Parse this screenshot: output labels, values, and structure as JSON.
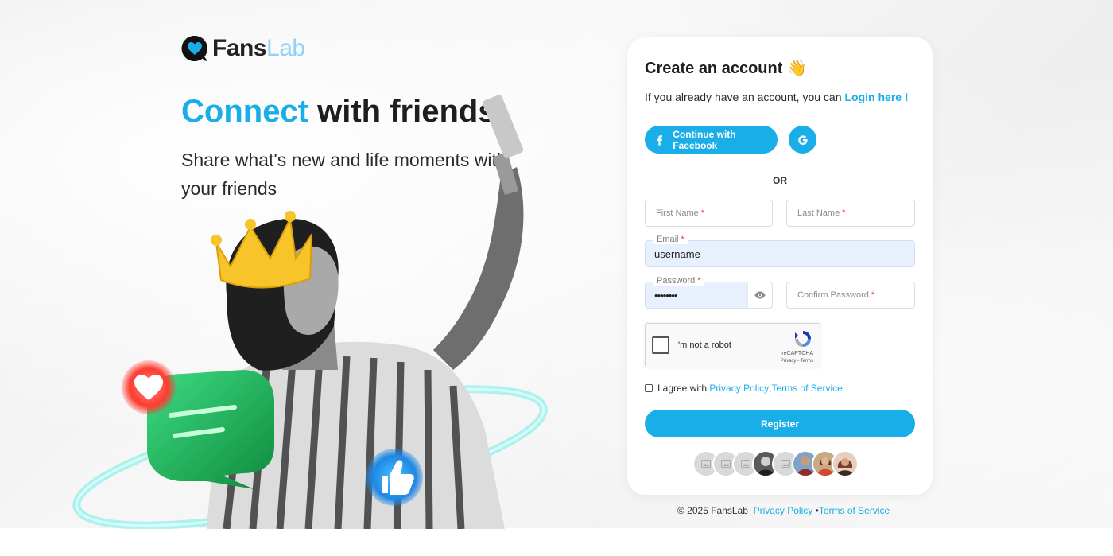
{
  "brand": {
    "name_main": "Fans",
    "name_accent": "Lab"
  },
  "hero": {
    "headline_accent": "Connect",
    "headline_rest": " with friends",
    "subline": "Share what's new and life moments with your friends"
  },
  "form": {
    "title": "Create an account",
    "title_emoji": "👋",
    "have_account_text": "If you already have an account, you can",
    "login_link": "Login here !",
    "facebook_label": "Continue with Facebook",
    "or_text": "OR",
    "first_name_placeholder": "First Name",
    "last_name_placeholder": "Last Name",
    "email_label": "Email",
    "email_value": "username",
    "password_label": "Password",
    "password_value": "••••••••",
    "confirm_password_placeholder": "Confirm Password",
    "required_mark": "*",
    "captcha_label": "I'm not a robot",
    "captcha_brand": "reCAPTCHA",
    "captcha_links": "Privacy - Terms",
    "agree_text": "I agree with",
    "privacy_link": "Privacy Policy",
    "separator": ",",
    "terms_link": "Terms of Service",
    "register_label": "Register"
  },
  "footer": {
    "copyright": "© 2025 FansLab",
    "privacy_link": "Privacy Policy",
    "bullet": "•",
    "terms_link": "Terms of Service"
  },
  "colors": {
    "accent": "#19aee8",
    "required": "#e53935",
    "autofill": "#e8f0fe"
  }
}
